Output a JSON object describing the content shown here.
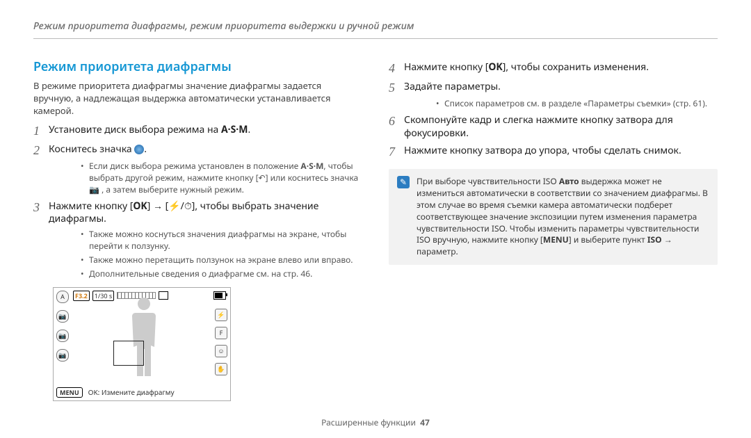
{
  "page_header": "Режим приоритета диафрагмы, режим приоритета выдержки и ручной режим",
  "footer": {
    "label": "Расширенные функции",
    "page_no": "47"
  },
  "left": {
    "title": "Режим приоритета диафрагмы",
    "intro": "В режиме приоритета диафрагмы значение диафрагмы задается вручную, а надлежащая выдержка автоматически устанавливается камерой.",
    "step1_pre": "Установите диск выбора режима на ",
    "step1_glyph": "A·S·M",
    "step1_post": ".",
    "step2_pre": "Коснитесь  значка ",
    "step2_post": ".",
    "step2_bullet_a": "Если диск выбора режима установлен в положение ",
    "step2_bullet_a_glyph": "A·S·M",
    "step2_bullet_a_mid": ", чтобы выбрать другой режим, нажмите кнопку [",
    "step2_bullet_a_back": "↶",
    "step2_bullet_a_mid2": "] или коснитесь значка ",
    "step2_bullet_a_cam": "📷",
    "step2_bullet_a_end": " , а затем выберите нужный режим.",
    "step3_pre": "Нажмите кнопку [",
    "step3_ok": "OK",
    "step3_arrow": "] → [",
    "step3_flash": "⚡/",
    "step3_timer": "⏱",
    "step3_post": "], чтобы выбрать значение диафрагмы.",
    "step3_bullets": [
      "Также можно коснуться значения диафрагмы на экране, чтобы перейти к ползунку.",
      "Также можно перетащить ползунок на экране влево или вправо.",
      "Дополнительные сведения о диафрагме см. на стр. 46."
    ],
    "screenshot": {
      "aperture": "F3.2",
      "shutter": "1/30 s",
      "menu_label": "MENU",
      "bottom_text": "OK: Измените диафрагму"
    }
  },
  "right": {
    "step4_pre": "Нажмите кнопку [",
    "step4_ok": "OK",
    "step4_post": "], чтобы сохранить изменения.",
    "step5": "Задайте параметры.",
    "step5_bullet": "Список параметров см. в разделе «Параметры съемки» (стр. 61).",
    "step6": "Скомпонуйте кадр и слегка нажмите кнопку затвора для фокусировки.",
    "step7": "Нажмите кнопку затвора до упора, чтобы сделать снимок.",
    "note": {
      "a": "При выборе чувствительности ISO ",
      "auto": "Авто",
      "b": " выдержка может не измениться автоматически в соответствии со значением диафрагмы. В этом случае во время съемки камера автоматически подберет соответствующее значение экспозиции путем изменения параметра чувствительности ISO. Чтобы изменить параметры чувствительности ISO вручную, нажмите кнопку [",
      "menu": "MENU",
      "c": "] и выберите пункт ",
      "iso": "ISO",
      "d": " → параметр."
    }
  }
}
